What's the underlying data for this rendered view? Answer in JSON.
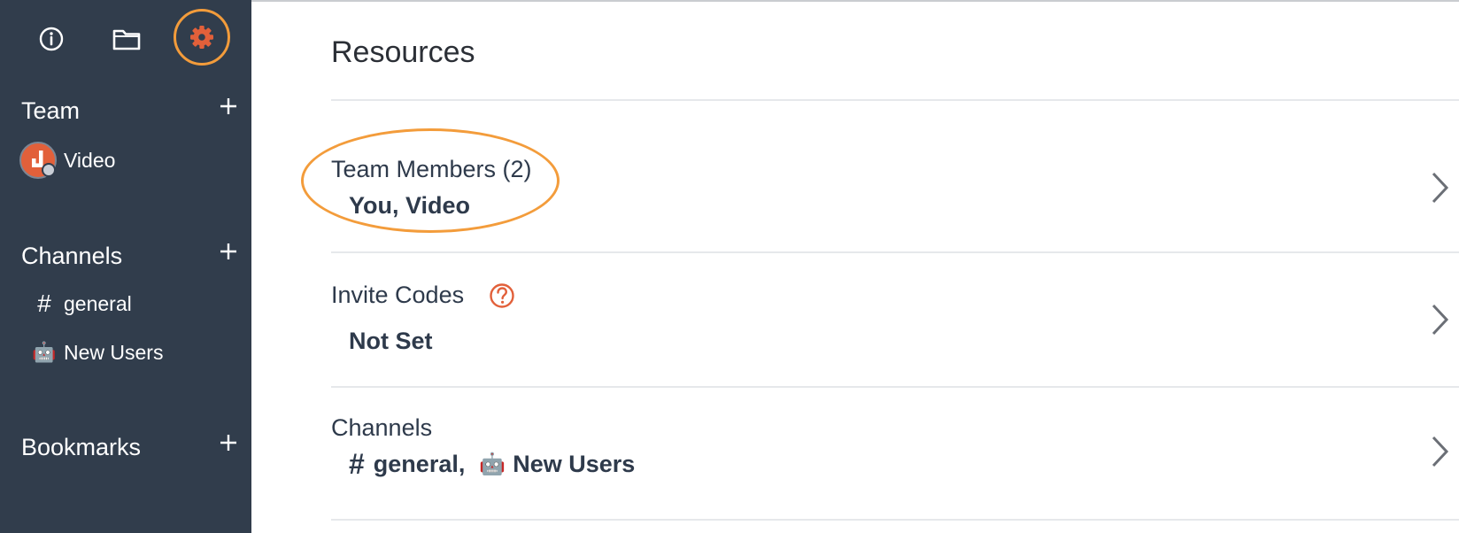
{
  "sidebar": {
    "top_icons": [
      {
        "name": "info-icon"
      },
      {
        "name": "folder-icon"
      },
      {
        "name": "gear-icon"
      }
    ],
    "team_section": {
      "label": "Team",
      "items": [
        {
          "name": "Video"
        }
      ]
    },
    "channels_section": {
      "label": "Channels",
      "items": [
        {
          "icon": "#",
          "name": "general"
        },
        {
          "icon": "🤖",
          "name": "New Users"
        }
      ]
    },
    "bookmarks_section": {
      "label": "Bookmarks"
    }
  },
  "main": {
    "title": "Resources",
    "rows": [
      {
        "title": "Team Members (2)",
        "value": "You, Video"
      },
      {
        "title": "Invite Codes",
        "value": "Not Set"
      },
      {
        "title": "Channels",
        "value_channels": [
          {
            "icon": "#",
            "name": "general,"
          },
          {
            "icon": "🤖",
            "name": "New Users"
          }
        ]
      }
    ]
  },
  "colors": {
    "sidebar_bg": "#313d4c",
    "highlight": "#f39c3b",
    "accent_red": "#e2603a",
    "text_dark": "#2e3a4b"
  }
}
